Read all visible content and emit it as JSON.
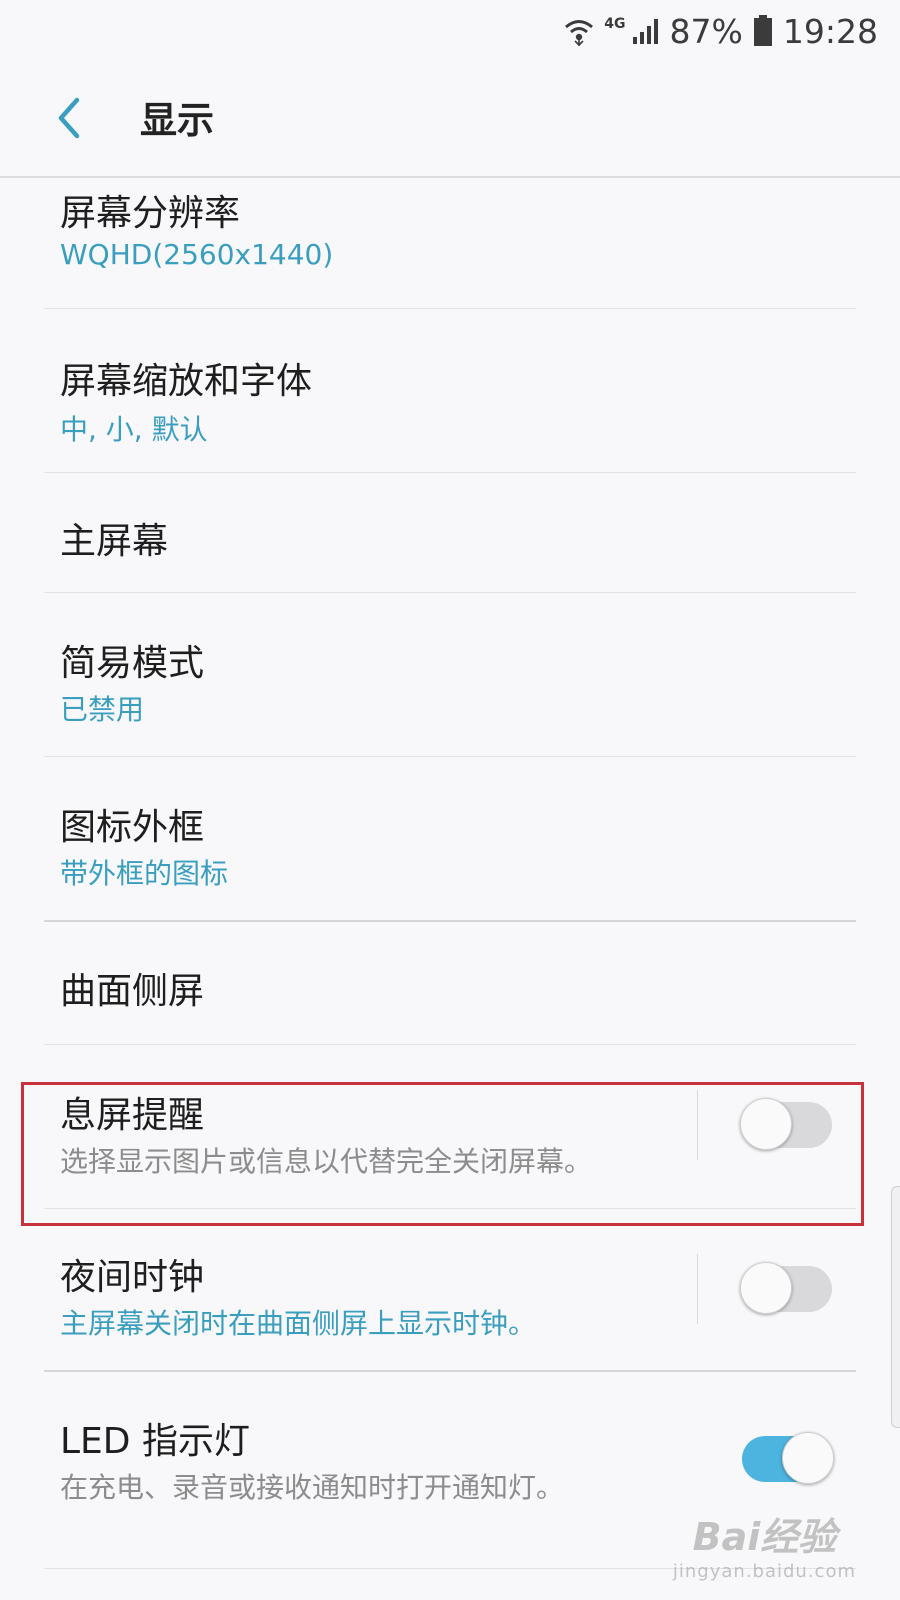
{
  "status_bar": {
    "network": "4G",
    "battery_percent": "87%",
    "time": "19:28",
    "icons": [
      "wifi-icon",
      "signal-icon",
      "battery-icon"
    ]
  },
  "header": {
    "title": "显示",
    "back_icon": "chevron-left-icon"
  },
  "settings": {
    "items": [
      {
        "title": "屏幕分辨率",
        "subtitle": "WQHD(2560x1440)"
      },
      {
        "title": "屏幕缩放和字体",
        "subtitle": "中, 小, 默认"
      },
      {
        "title": "主屏幕"
      },
      {
        "title": "简易模式",
        "subtitle": "已禁用"
      },
      {
        "title": "图标外框",
        "subtitle": "带外框的图标"
      },
      {
        "title": "曲面侧屏"
      },
      {
        "title": "息屏提醒",
        "subtitle": "选择显示图片或信息以代替完全关闭屏幕。",
        "toggle": "off"
      },
      {
        "title": "夜间时钟",
        "subtitle": "主屏幕关闭时在曲面侧屏上显示时钟。",
        "toggle": "off"
      },
      {
        "title": "LED 指示灯",
        "subtitle": "在充电、录音或接收通知时打开通知灯。",
        "toggle": "on"
      }
    ]
  },
  "watermark": {
    "brand": "Bai经验",
    "url": "jingyan.baidu.com"
  },
  "colors": {
    "accent": "#3a9ebf",
    "toggle_on": "#4db3df",
    "highlight": "#c8323a"
  }
}
